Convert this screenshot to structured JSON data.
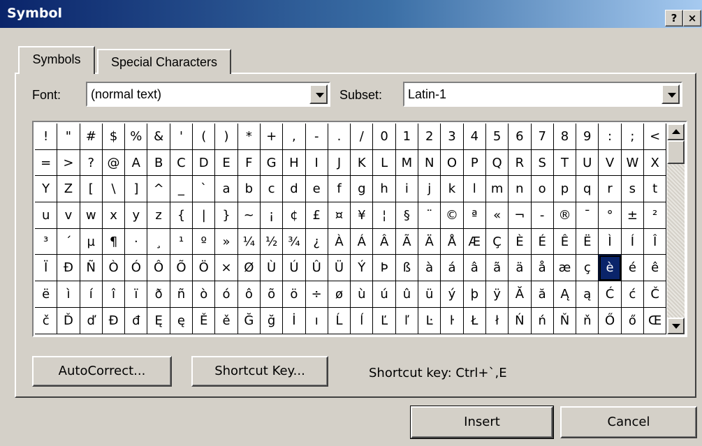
{
  "window": {
    "title": "Symbol",
    "help_glyph": "?",
    "close_glyph": "×"
  },
  "tabs": [
    {
      "label": "Symbols",
      "active": true
    },
    {
      "label": "Special Characters",
      "active": false
    }
  ],
  "font": {
    "label": "Font:",
    "value": "(normal text)"
  },
  "subset": {
    "label": "Subset:",
    "value": "Latin-1"
  },
  "grid": {
    "rows": [
      [
        "!",
        "\"",
        "#",
        "$",
        "%",
        "&",
        "'",
        "(",
        ")",
        "*",
        "+",
        ",",
        "-",
        ".",
        "/",
        "0",
        "1",
        "2",
        "3",
        "4",
        "5",
        "6",
        "7",
        "8",
        "9",
        ":",
        ";",
        "<"
      ],
      [
        "=",
        ">",
        "?",
        "@",
        "A",
        "B",
        "C",
        "D",
        "E",
        "F",
        "G",
        "H",
        "I",
        "J",
        "K",
        "L",
        "M",
        "N",
        "O",
        "P",
        "Q",
        "R",
        "S",
        "T",
        "U",
        "V",
        "W",
        "X"
      ],
      [
        "Y",
        "Z",
        "[",
        "\\",
        "]",
        "^",
        "_",
        "`",
        "a",
        "b",
        "c",
        "d",
        "e",
        "f",
        "g",
        "h",
        "i",
        "j",
        "k",
        "l",
        "m",
        "n",
        "o",
        "p",
        "q",
        "r",
        "s",
        "t"
      ],
      [
        "u",
        "v",
        "w",
        "x",
        "y",
        "z",
        "{",
        "|",
        "}",
        "~",
        "¡",
        "¢",
        "£",
        "¤",
        "¥",
        "¦",
        "§",
        "¨",
        "©",
        "ª",
        "«",
        "¬",
        "-",
        "®",
        "¯",
        "°",
        "±",
        "²"
      ],
      [
        "³",
        "´",
        "µ",
        "¶",
        "·",
        "¸",
        "¹",
        "º",
        "»",
        "¼",
        "½",
        "¾",
        "¿",
        "À",
        "Á",
        "Â",
        "Ã",
        "Ä",
        "Å",
        "Æ",
        "Ç",
        "È",
        "É",
        "Ê",
        "Ë",
        "Ì",
        "Í",
        "Î"
      ],
      [
        "Ï",
        "Ð",
        "Ñ",
        "Ò",
        "Ó",
        "Ô",
        "Õ",
        "Ö",
        "×",
        "Ø",
        "Ù",
        "Ú",
        "Û",
        "Ü",
        "Ý",
        "Þ",
        "ß",
        "à",
        "á",
        "â",
        "ã",
        "ä",
        "å",
        "æ",
        "ç",
        "è",
        "é",
        "ê"
      ],
      [
        "ë",
        "ì",
        "í",
        "î",
        "ï",
        "ð",
        "ñ",
        "ò",
        "ó",
        "ô",
        "õ",
        "ö",
        "÷",
        "ø",
        "ù",
        "ú",
        "û",
        "ü",
        "ý",
        "þ",
        "ÿ",
        "Ă",
        "ă",
        "Ą",
        "ą",
        "Ć",
        "ć",
        "Č"
      ],
      [
        "č",
        "Ď",
        "ď",
        "Đ",
        "đ",
        "Ę",
        "ę",
        "Ě",
        "ě",
        "Ğ",
        "ğ",
        "İ",
        "ı",
        "Ĺ",
        "ĺ",
        "Ľ",
        "ľ",
        "Ŀ",
        "ŀ",
        "Ł",
        "ł",
        "Ń",
        "ń",
        "Ň",
        "ň",
        "Ő",
        "ő",
        "Œ"
      ]
    ],
    "selected": "è"
  },
  "buttons": {
    "autocorrect": "AutoCorrect...",
    "shortcut_key": "Shortcut Key...",
    "insert": "Insert",
    "cancel": "Cancel"
  },
  "shortcut_info": "Shortcut key: Ctrl+`,E"
}
